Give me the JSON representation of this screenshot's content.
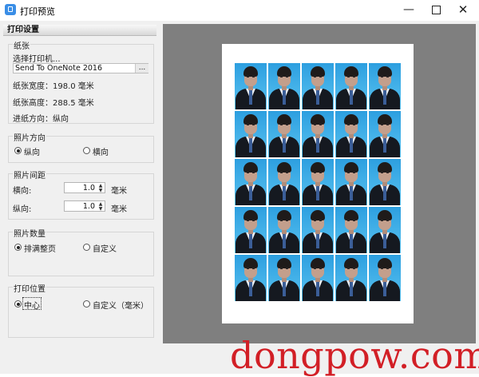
{
  "window": {
    "title": "打印预览",
    "minimize_glyph": "—",
    "close_glyph": "✕"
  },
  "settings": {
    "header": "打印设置",
    "paper": {
      "group_title": "纸张",
      "select_printer_label": "选择打印机...",
      "printer_name": "Send To OneNote 2016",
      "browse_button": "...",
      "width_label": "纸张宽度：198.0 毫米",
      "height_label": "纸张高度：288.5 毫米",
      "feed_label": "进纸方向：纵向"
    },
    "orientation": {
      "group_title": "照片方向",
      "portrait": "纵向",
      "landscape": "横向",
      "selected": "纵向"
    },
    "spacing": {
      "group_title": "照片间距",
      "horizontal_label": "横向:",
      "horizontal_value": "1.0",
      "vertical_label": "纵向:",
      "vertical_value": "1.0",
      "unit": "毫米"
    },
    "count": {
      "group_title": "照片数量",
      "fill_page": "排满整页",
      "custom": "自定义",
      "selected": "排满整页"
    },
    "position": {
      "group_title": "打印位置",
      "center": "中心",
      "custom_mm": "自定义（毫米）",
      "selected": "中心"
    }
  },
  "preview": {
    "rows": 5,
    "columns": 5
  },
  "watermark": "dongpow.com"
}
